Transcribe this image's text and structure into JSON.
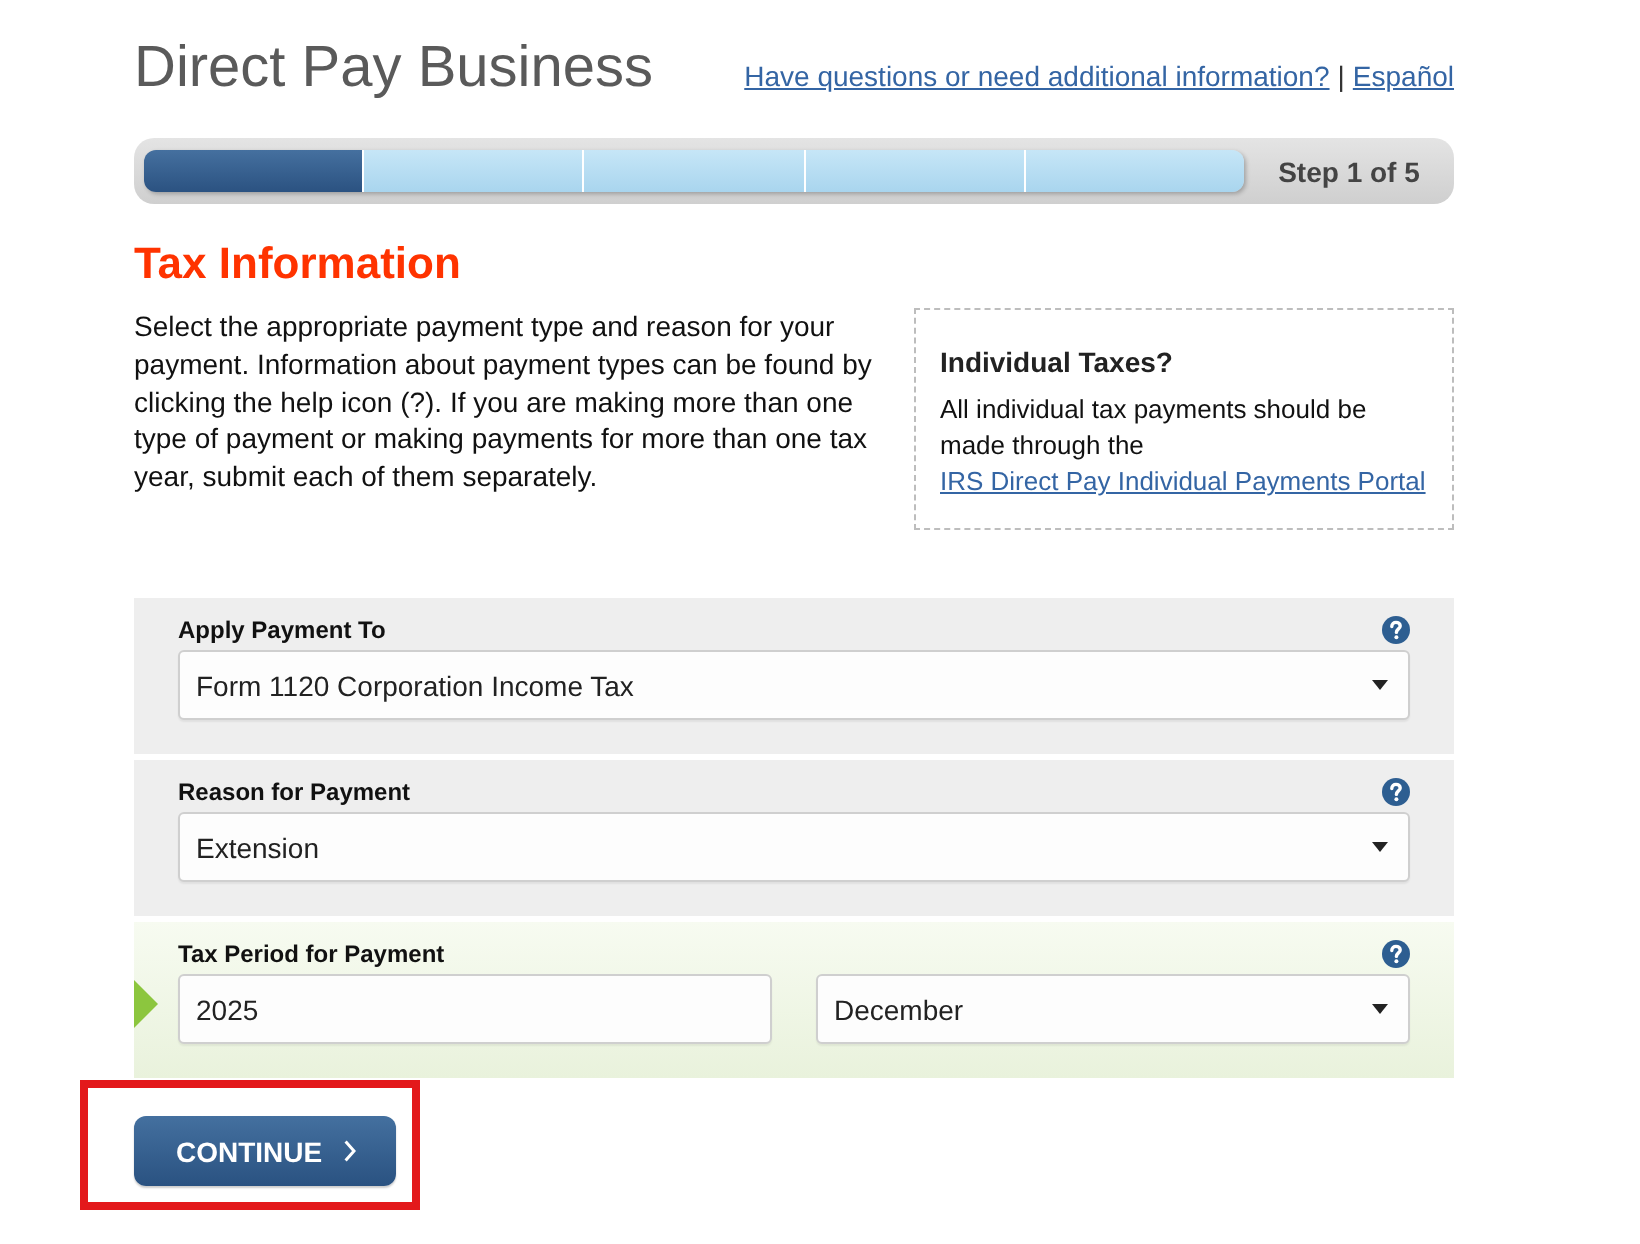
{
  "header": {
    "title": "Direct Pay Business",
    "help_link": "Have questions or need additional information?",
    "separator": "|",
    "language_link": "Español"
  },
  "progress": {
    "segments": [
      {
        "done": true
      },
      {
        "done": false
      },
      {
        "done": false
      },
      {
        "done": false
      },
      {
        "done": false
      }
    ],
    "label": "Step 1 of 5"
  },
  "section": {
    "heading": "Tax Information",
    "intro": "Select the appropriate payment type and reason for your payment. Information about payment types can be found by clicking the help icon (?). If you are making more than one type of payment or making payments for more than one tax year, submit each of them separately.",
    "aside": {
      "title": "Individual Taxes?",
      "text": "All individual tax payments should be made through the",
      "link": "IRS Direct Pay Individual Payments Portal"
    }
  },
  "fields": [
    {
      "label": "Apply Payment To",
      "active": false,
      "controls": [
        {
          "kind": "select",
          "value": "Form 1120 Corporation Income Tax"
        }
      ]
    },
    {
      "label": "Reason for Payment",
      "active": false,
      "controls": [
        {
          "kind": "select",
          "value": "Extension"
        }
      ]
    },
    {
      "label": "Tax Period for Payment",
      "active": true,
      "controls": [
        {
          "kind": "text",
          "value": "2025"
        },
        {
          "kind": "select",
          "value": "December"
        }
      ]
    }
  ],
  "continue_button": {
    "label": "CONTINUE",
    "highlighted": true
  }
}
